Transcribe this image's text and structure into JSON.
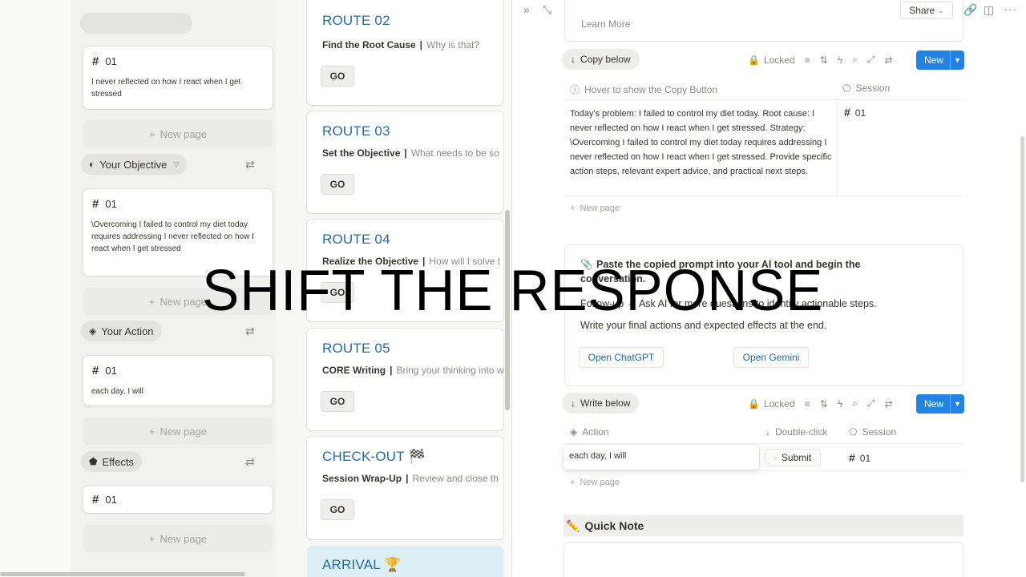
{
  "caption": "SHIFT THE RESPONSE",
  "colors": {
    "accent": "#2383e2",
    "route_title": "#2a6a9c",
    "arrival_bg": "#dceef6"
  },
  "left_board": {
    "root_cause": {
      "card_session": "01",
      "card_text": "I never reflected on how I react when I get stressed",
      "new_page_label": "New page"
    },
    "objective": {
      "group_label": "Your Objective",
      "icon": "objective-icon",
      "card_session": "01",
      "card_text": "\\Overcoming I failed to control my diet today requires addressing I never reflected on how I react when I get stressed",
      "new_page_label": "New page"
    },
    "action": {
      "group_label": "Your Action",
      "icon": "action-icon",
      "card_session": "01",
      "card_text": "each day, I will",
      "new_page_label": "New page"
    },
    "effects": {
      "group_label": "Effects",
      "icon": "effects-icon",
      "card_session": "01",
      "new_page_label": "New page"
    }
  },
  "routes": [
    {
      "title": "ROUTE 02",
      "subtitle": "Find the Root Cause",
      "hint": "Why is that?",
      "go": "GO"
    },
    {
      "title": "ROUTE 03",
      "subtitle": "Set the Objective",
      "hint": "What needs to be so",
      "go": "GO"
    },
    {
      "title": "ROUTE 04",
      "subtitle": "Realize the Objective",
      "hint": "How will I solve t",
      "go": "GO"
    },
    {
      "title": "ROUTE 05",
      "subtitle": "CORE Writing",
      "hint": "Bring your thinking into w",
      "go": "GO"
    },
    {
      "title": "CHECK-OUT 🏁",
      "subtitle": "Session Wrap-Up",
      "hint": "Review and close th",
      "go": "GO"
    },
    {
      "title": "ARRIVAL 🏆"
    }
  ],
  "right_panel": {
    "share_label": "Share",
    "learn_more": "Learn More",
    "copy_section": {
      "pill_label": "Copy below",
      "locked_label": "Locked",
      "new_label": "New",
      "col_prompt": "Hover to show the Copy Button",
      "col_session": "Session",
      "prompt_text": "Today's problem: I failed to control my diet today. Root cause: I never reflected on how I react when I get stressed. Strategy: \\Overcoming I failed to control my diet today requires addressing I never reflected on how I react when I get stressed. Provide specific action steps, relevant expert advice, and practical next steps.",
      "session_value": "01",
      "new_page_label": "New page"
    },
    "callout": {
      "line1": "Paste the copied prompt into your AI tool and begin the",
      "line2": "conversation.",
      "line3_prefix": "Follow-up →",
      "line3_rest": "Ask AI for more questions to identify actionable steps.",
      "line4": "Write your final actions and expected effects at the end.",
      "btn_chatgpt": "Open ChatGPT",
      "btn_gemini": "Open Gemini"
    },
    "write_section": {
      "pill_label": "Write below",
      "locked_label": "Locked",
      "new_label": "New",
      "col_action": "Action",
      "col_double": "Double-click",
      "col_session": "Session",
      "action_value": "each day, I will",
      "submit_label": "Submit",
      "session_value": "01",
      "new_page_label": "New page"
    },
    "quick_note": "Quick Note"
  }
}
